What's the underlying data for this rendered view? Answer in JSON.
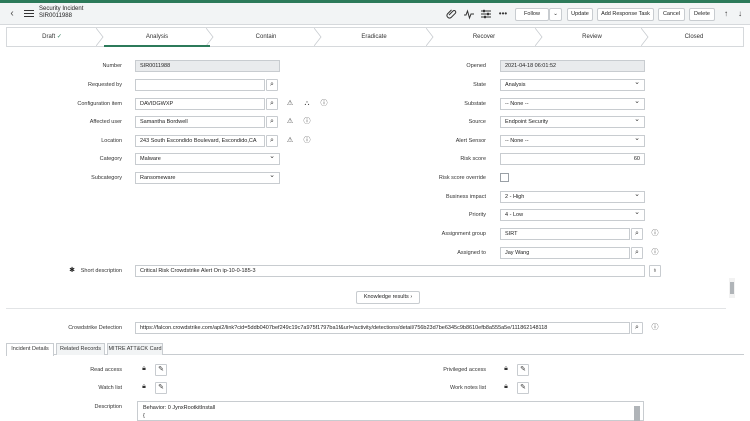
{
  "header": {
    "title": "Security Incident",
    "number": "SIR0011988",
    "buttons": {
      "follow": "Follow",
      "update": "Update",
      "add_response_task": "Add Response Task",
      "cancel": "Cancel",
      "delete": "Delete"
    }
  },
  "stages": [
    {
      "label": "Draft"
    },
    {
      "label": "Analysis"
    },
    {
      "label": "Contain"
    },
    {
      "label": "Eradicate"
    },
    {
      "label": "Recover"
    },
    {
      "label": "Review"
    },
    {
      "label": "Closed"
    }
  ],
  "form": {
    "number": {
      "label": "Number",
      "value": "SIR0011988"
    },
    "requested_by": {
      "label": "Requested by",
      "value": ""
    },
    "configuration_item": {
      "label": "Configuration item",
      "value": "DAVIDGWXP"
    },
    "affected_user": {
      "label": "Affected user",
      "value": "Samantha Bordwell"
    },
    "location": {
      "label": "Location",
      "value": "243 South Escondido Boulevard, Escondido,CA"
    },
    "category": {
      "label": "Category",
      "value": "Malware"
    },
    "subcategory": {
      "label": "Subcategory",
      "value": "Ransomeware"
    },
    "opened": {
      "label": "Opened",
      "value": "2021-04-18 06:01:52"
    },
    "state": {
      "label": "State",
      "value": "Analysis"
    },
    "substate": {
      "label": "Substate",
      "value": "-- None --"
    },
    "source": {
      "label": "Source",
      "value": "Endpoint Security"
    },
    "alert_sensor": {
      "label": "Alert Sensor",
      "value": "-- None --"
    },
    "risk_score": {
      "label": "Risk score",
      "value": "60"
    },
    "risk_score_override": {
      "label": "Risk score override"
    },
    "business_impact": {
      "label": "Business impact",
      "value": "2 - High"
    },
    "priority": {
      "label": "Priority",
      "value": "4 - Low"
    },
    "assignment_group": {
      "label": "Assignment group",
      "value": "SIRT"
    },
    "assigned_to": {
      "label": "Assigned to",
      "value": "Jay Wang"
    },
    "short_description": {
      "label": "Short description",
      "value": "Critical Risk Crowdstrike Alert On ip-10-0-185-3"
    },
    "knowledge_results": "Knowledge results",
    "crowdstrike_detection": {
      "label": "Crowdstrike Detection",
      "value": "https://falcon.crowdstrike.com/api2/link?cid=5ddb0407bef249c19c7a975f1797ba1f&url=/activity/detections/detail/756b23d7be6345c9b8610efb8a555a5e/111862148118"
    }
  },
  "tabs": [
    {
      "label": "Incident Details"
    },
    {
      "label": "Related Records"
    },
    {
      "label": "MITRE ATT&CK Card"
    }
  ],
  "details": {
    "read_access": "Read access",
    "watch_list": "Watch list",
    "privileged_access": "Privileged access",
    "work_notes_list": "Work notes list",
    "description": {
      "label": "Description",
      "line1": "Behavior: 0 JynxRootkitInstall",
      "line2": "{"
    }
  },
  "colors": {
    "accent": "#2c7a5a"
  }
}
